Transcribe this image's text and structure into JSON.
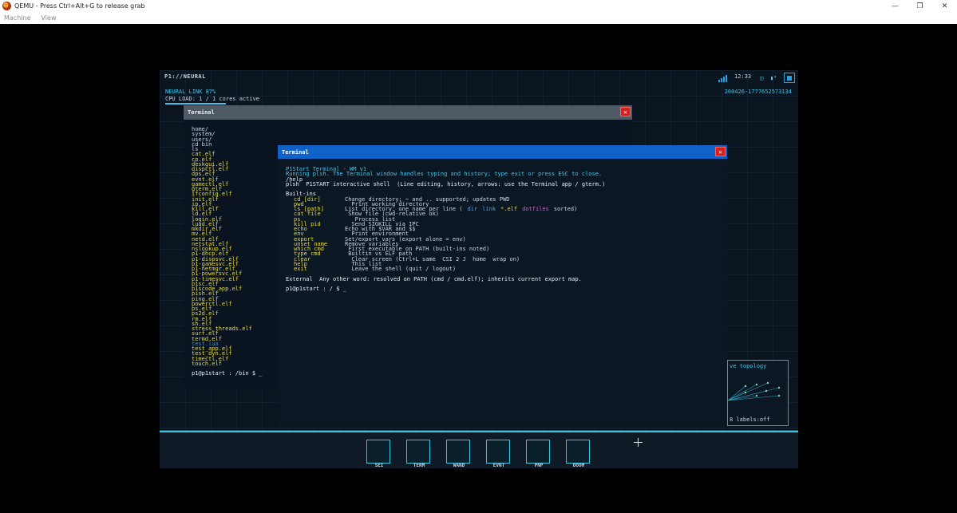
{
  "host": {
    "title": "QEMU - Press Ctrl+Alt+G to release grab",
    "menu": [
      "Machine",
      "View"
    ],
    "controls": {
      "minimize": "—",
      "restore": "❐",
      "close": "✕"
    }
  },
  "topbar": {
    "brand": "P1://NEURAL",
    "clock": "12:33",
    "tray1": "◫",
    "tray2": "▮⁴",
    "neural": "NEURAL LINK 87%",
    "cpu": "CPU LOAD: 1 / 1 cores active",
    "session": "260426-1777652573134"
  },
  "term1": {
    "title": "Terminal",
    "close": "✕",
    "entries": [
      {
        "t": "home/",
        "k": "dir"
      },
      {
        "t": "system/",
        "k": "dir"
      },
      {
        "t": "users/",
        "k": "dir"
      },
      {
        "t": "cd bin",
        "k": "file"
      },
      {
        "t": "ls",
        "k": "file"
      },
      {
        "t": "cat.elf",
        "k": "exe"
      },
      {
        "t": "cp.elf",
        "k": "exe"
      },
      {
        "t": "deskgui.elf",
        "k": "exe"
      },
      {
        "t": "dispctl.elf",
        "k": "exe"
      },
      {
        "t": "dps.elf",
        "k": "exe"
      },
      {
        "t": "evnt.elf",
        "k": "exe"
      },
      {
        "t": "gamectl.elf",
        "k": "exe"
      },
      {
        "t": "gterm.elf",
        "k": "exe"
      },
      {
        "t": "ifconfig.elf",
        "k": "exe"
      },
      {
        "t": "init.elf",
        "k": "exe"
      },
      {
        "t": "ip.elf",
        "k": "exe"
      },
      {
        "t": "kill.elf",
        "k": "exe"
      },
      {
        "t": "ld.elf",
        "k": "exe"
      },
      {
        "t": "login.elf",
        "k": "exe"
      },
      {
        "t": "luad.elf",
        "k": "exe"
      },
      {
        "t": "mkdir.elf",
        "k": "exe"
      },
      {
        "t": "mv.elf",
        "k": "exe"
      },
      {
        "t": "netd.elf",
        "k": "exe"
      },
      {
        "t": "netstat.elf",
        "k": "exe"
      },
      {
        "t": "nslookup.elf",
        "k": "exe"
      },
      {
        "t": "p1-dhcp.elf",
        "k": "exe"
      },
      {
        "t": "p1-dispsvc.elf",
        "k": "exe"
      },
      {
        "t": "p1-gamesvc.elf",
        "k": "exe"
      },
      {
        "t": "p1-netmgr.elf",
        "k": "exe"
      },
      {
        "t": "p1-powersvc.elf",
        "k": "exe"
      },
      {
        "t": "p1-timesvc.elf",
        "k": "exe"
      },
      {
        "t": "p1sc.elf",
        "k": "exe"
      },
      {
        "t": "p1scode_app.elf",
        "k": "exe"
      },
      {
        "t": "pish.elf",
        "k": "exe"
      },
      {
        "t": "ping.elf",
        "k": "exe"
      },
      {
        "t": "powerctl.elf",
        "k": "exe"
      },
      {
        "t": "ps.elf",
        "k": "exe"
      },
      {
        "t": "ps2d.elf",
        "k": "exe"
      },
      {
        "t": "rm.elf",
        "k": "exe"
      },
      {
        "t": "sh.elf",
        "k": "exe"
      },
      {
        "t": "stress_threads.elf",
        "k": "exe"
      },
      {
        "t": "surf.elf",
        "k": "exe"
      },
      {
        "t": "termd.elf",
        "k": "exe"
      },
      {
        "t": "test.lua",
        "k": "lua"
      },
      {
        "t": "test_app.elf",
        "k": "exe"
      },
      {
        "t": "test_dyn.elf",
        "k": "exe"
      },
      {
        "t": "timectl.elf",
        "k": "exe"
      },
      {
        "t": "touch.elf",
        "k": "exe"
      }
    ],
    "prompt": "p1@p1start : /bin $ _"
  },
  "term2": {
    "title": "Terminal",
    "close": "✕",
    "banner_title": "P1Start Terminal - WM v1",
    "banner_desc": "Running plsh. The Terminal window handles typing and history; type exit or press ESC to close.",
    "cmd_help": "/help",
    "intro": "plsh  P1START interactive shell  (Line editing, history, arrows: use the Terminal app / gterm.)",
    "builtins_header": "Built-ins",
    "builtins": [
      {
        "cmd": "cd [dir]",
        "desc": "Change directory; ~ and .. supported; updates PWD"
      },
      {
        "cmd": "pwd",
        "desc": "  Print working directory"
      },
      {
        "cmd": "ls [path]",
        "desc": "List directory, one name per line ("
      },
      {
        "cmd": "cat file",
        "desc": " Show file (cwd-relative ok)"
      },
      {
        "cmd": "ps",
        "desc": "   Process list"
      },
      {
        "cmd": "kill pid",
        "desc": "  Send SIGKILL via IPC"
      },
      {
        "cmd": "echo",
        "desc": "Echo with $VAR and $$"
      },
      {
        "cmd": "env",
        "desc": "  Print environment"
      },
      {
        "cmd": "export",
        "desc": "Set/export vars (export alone = env)"
      },
      {
        "cmd": "unset name",
        "desc": "Remove variables"
      },
      {
        "cmd": "which cmd",
        "desc": " First executable on PATH (built-ins noted)"
      },
      {
        "cmd": "type cmd",
        "desc": " Builtin vs ELF path"
      },
      {
        "cmd": "clear",
        "desc": "  Clear screen (Ctrl+L same  CSI 2 J  home  wrap on)"
      },
      {
        "cmd": "help",
        "desc": "  This list"
      },
      {
        "cmd": "exit",
        "desc": "  Leave the shell (quit / logout)"
      }
    ],
    "ls_dir": "dir",
    "ls_link": "link",
    "ls_elf": "*.elf",
    "ls_dotfiles": "dotfiles",
    "ls_sorted": "sorted)",
    "external": "External  Any other word: resolved on PATH (cmd / cmd.elf); inherits current export map.",
    "prompt": "p1@p1start : / $ _"
  },
  "topology": {
    "title": "ve topology",
    "footer": "8  labels:off"
  },
  "dock": {
    "items": [
      {
        "label": "SEI"
      },
      {
        "label": "TERM"
      },
      {
        "label": "WAND"
      },
      {
        "label": "EVNT"
      },
      {
        "label": "PNP"
      },
      {
        "label": "DOOM"
      }
    ]
  },
  "colors": {
    "accent": "#35c6e0",
    "exe": "#e8d840",
    "active_title": "#1062c8",
    "close": "#d02020"
  },
  "cpu_fraction": 1.0
}
